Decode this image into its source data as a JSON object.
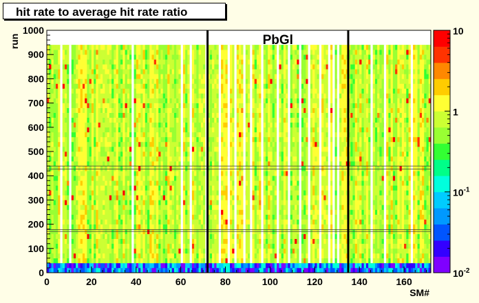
{
  "chart_data": {
    "type": "heatmap",
    "title": "hit rate to average hit rate ratio",
    "xlabel": "SM#",
    "ylabel": "run",
    "xlim": [
      0,
      172
    ],
    "ylim": [
      0,
      1000
    ],
    "x_ticks": [
      0,
      20,
      40,
      60,
      80,
      100,
      120,
      140,
      160
    ],
    "y_ticks": [
      0,
      100,
      200,
      300,
      400,
      500,
      600,
      700,
      800,
      900,
      1000
    ],
    "color_scale": "log",
    "z_range": [
      0.01,
      10
    ],
    "colorbar_ticks": [
      {
        "base": "10",
        "exp": "-2"
      },
      {
        "base": "10",
        "exp": "-1"
      },
      {
        "base": "1",
        "exp": ""
      },
      {
        "base": "10",
        "exp": ""
      }
    ],
    "annotation": "PbGl",
    "region_boundaries_x": [
      72,
      135
    ],
    "filled_runs": [
      0,
      940
    ],
    "dominant_ratio": 1.0,
    "palette": [
      "#7f00ff",
      "#3300ff",
      "#0055ff",
      "#0099ff",
      "#00ccff",
      "#00ffdd",
      "#00ff88",
      "#33ff33",
      "#99ff33",
      "#ccff33",
      "#ffff33",
      "#ffcc00",
      "#ff8800",
      "#ff3300",
      "#ff0000"
    ]
  }
}
